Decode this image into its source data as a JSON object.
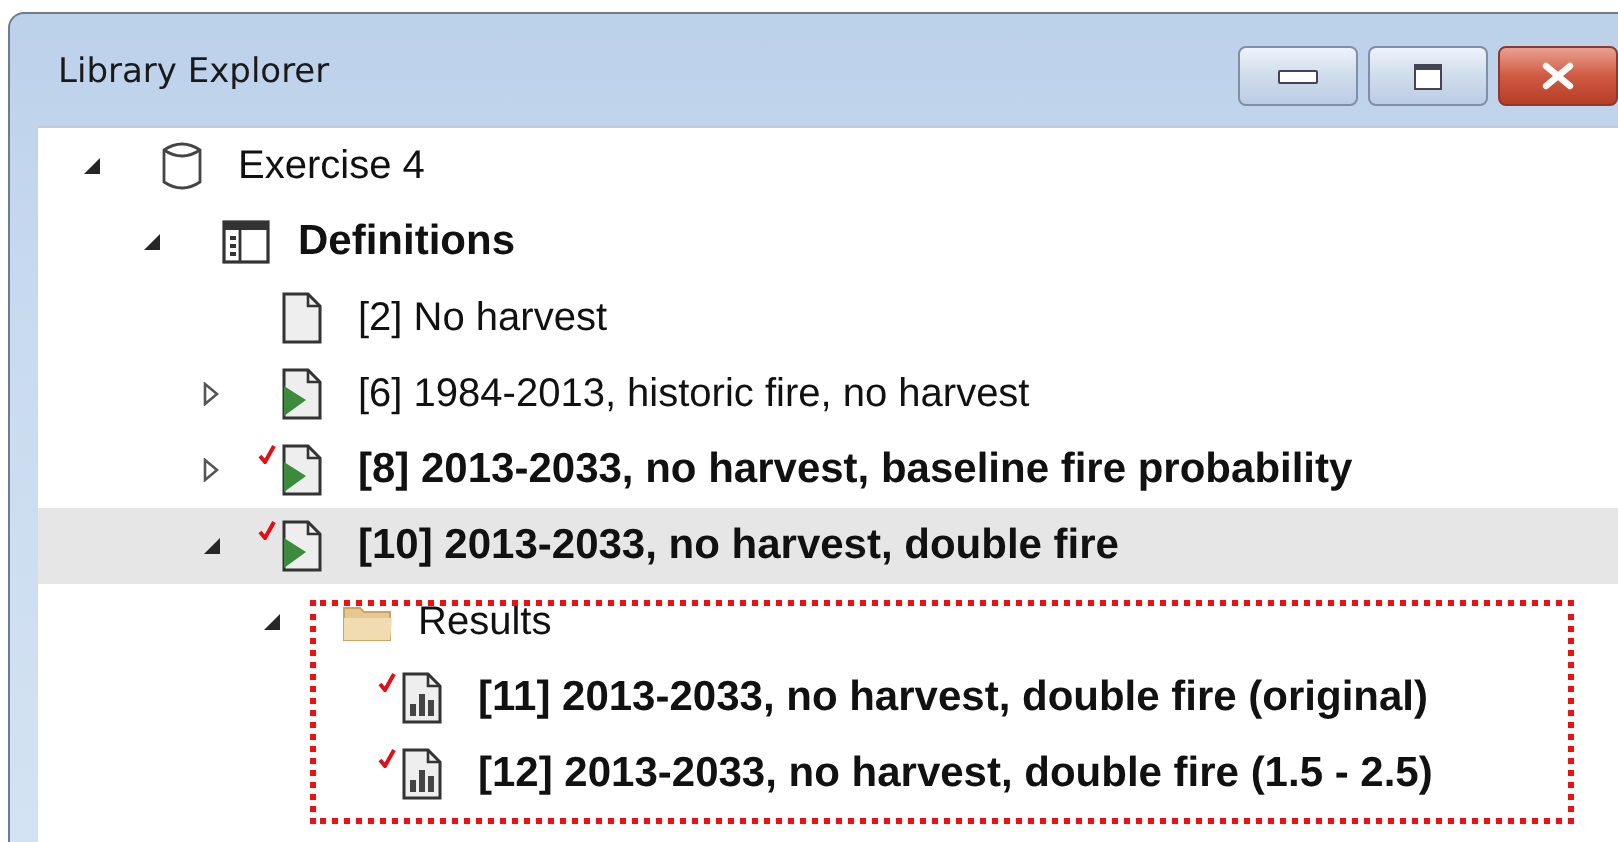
{
  "window": {
    "title": "Library Explorer"
  },
  "tree": [
    {
      "kind": "database",
      "label": "Exercise 4",
      "bold": false,
      "checked": false,
      "selected": false,
      "expanded": true,
      "children": [
        {
          "kind": "definitions",
          "label": "Definitions",
          "bold": true,
          "checked": false,
          "selected": false,
          "expanded": true,
          "children": [
            {
              "kind": "document",
              "label": "[2] No harvest",
              "bold": false,
              "checked": false,
              "selected": false
            },
            {
              "kind": "scenario",
              "label": "[6] 1984-2013, historic fire, no harvest",
              "bold": false,
              "checked": false,
              "selected": false,
              "expanded": false
            },
            {
              "kind": "scenario",
              "label": "[8] 2013-2033, no harvest, baseline fire probability",
              "bold": true,
              "checked": true,
              "selected": false,
              "expanded": false
            },
            {
              "kind": "scenario",
              "label": "[10] 2013-2033, no harvest, double fire",
              "bold": true,
              "checked": true,
              "selected": true,
              "expanded": true,
              "children": [
                {
                  "kind": "folder",
                  "label": "Results",
                  "bold": false,
                  "checked": false,
                  "selected": false,
                  "expanded": true,
                  "highlighted": true,
                  "children": [
                    {
                      "kind": "result",
                      "label": "[11] 2013-2033, no harvest, double fire (original)",
                      "bold": true,
                      "checked": true,
                      "selected": false
                    },
                    {
                      "kind": "result",
                      "label": "[12] 2013-2033, no harvest, double fire (1.5 - 2.5)",
                      "bold": true,
                      "checked": true,
                      "selected": false
                    }
                  ]
                }
              ]
            }
          ]
        }
      ]
    }
  ]
}
